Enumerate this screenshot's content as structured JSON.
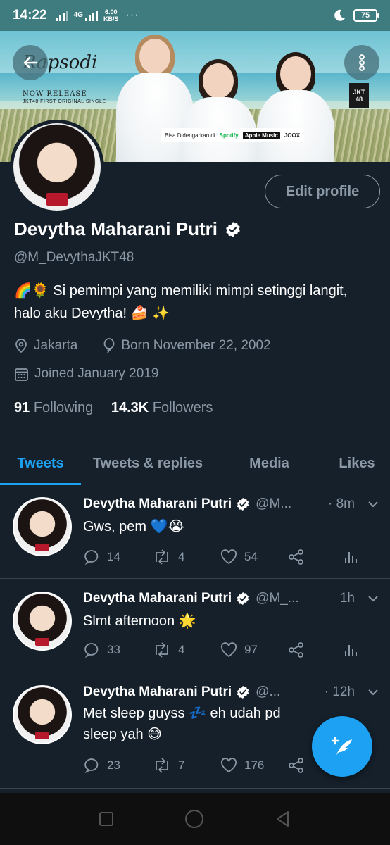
{
  "status_bar": {
    "time": "14:22",
    "network": "4G",
    "speed_value": "6.00",
    "speed_unit": "KB/S",
    "overflow": "···",
    "battery": "75"
  },
  "banner": {
    "title": "Rapsodi",
    "now_release": "NOW RELEASE",
    "single": "JKT48 FIRST ORIGINAL SINGLE",
    "stream_label": "Bisa Didengarkan di",
    "stream_services": [
      "Spotify",
      "Apple Music",
      "JOOX"
    ],
    "logo": "JKT 48"
  },
  "profile": {
    "name": "Devytha Maharani Putri",
    "handle": "@M_DevythaJKT48",
    "bio": "🌈🌻 Si pemimpi yang memiliki mimpi setinggi langit, halo aku Devytha! 🍰 ✨",
    "location": "Jakarta",
    "birthday": "Born November 22, 2002",
    "joined": "Joined January 2019",
    "following_count": "91",
    "following_label": "Following",
    "followers_count": "14.3K",
    "followers_label": "Followers",
    "edit_label": "Edit profile"
  },
  "tabs": [
    "Tweets",
    "Tweets & replies",
    "Media",
    "Likes"
  ],
  "tweets": [
    {
      "name": "Devytha Maharani Putri",
      "handle": "@M...",
      "time": "· 8m",
      "text": "Gws, pem 💙😭",
      "replies": "14",
      "retweets": "4",
      "likes": "54"
    },
    {
      "name": "Devytha Maharani Putri",
      "handle": "@M_...",
      "time": "1h",
      "text": "Slmt afternoon 🌟",
      "replies": "33",
      "retweets": "4",
      "likes": "97"
    },
    {
      "name": "Devytha Maharani Putri",
      "handle": "@...",
      "time": "· 12h",
      "text": "Met sleep guyss 💤 eh udah pd sleep yah 😅",
      "replies": "23",
      "retweets": "7",
      "likes": "176"
    }
  ],
  "colors": {
    "background": "#15202b",
    "accent": "#1da1f2",
    "secondary_text": "#8b98a5",
    "status_bar": "#3e7c80"
  }
}
